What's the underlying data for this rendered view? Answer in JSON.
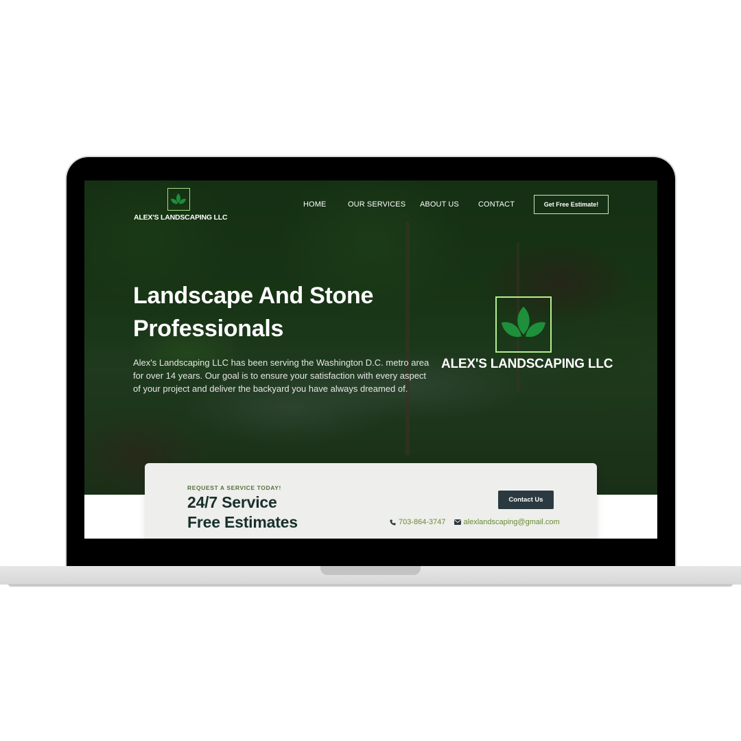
{
  "brand": {
    "name": "ALEX'S LANDSCAPING LLC"
  },
  "nav": {
    "items": [
      "HOME",
      "OUR SERVICES",
      "ABOUT US",
      "CONTACT"
    ],
    "cta": "Get Free Estimate!"
  },
  "hero": {
    "title": "Landscape And Stone Professionals",
    "text": "Alex's Landscaping LLC has been serving the Washington D.C. metro area for over 14 years. Our goal is to ensure your satisfaction with every aspect of your project and deliver the backyard you have always dreamed of.",
    "logo_name": "ALEX'S LANDSCAPING LLC"
  },
  "service_card": {
    "kicker": "REQUEST A SERVICE TODAY!",
    "title_line1": "24/7 Service",
    "title_line2": "Free Estimates",
    "button": "Contact Us",
    "phone": "703-864-3747",
    "email": "alexlandscaping@gmail.com"
  },
  "colors": {
    "accent_green": "#a8e08a",
    "leaf_green": "#1e8f3a",
    "dark_button": "#2b3a40",
    "contact_text": "#6a8a32"
  },
  "icons": [
    "leaf-logo-icon",
    "phone-icon",
    "envelope-icon"
  ]
}
